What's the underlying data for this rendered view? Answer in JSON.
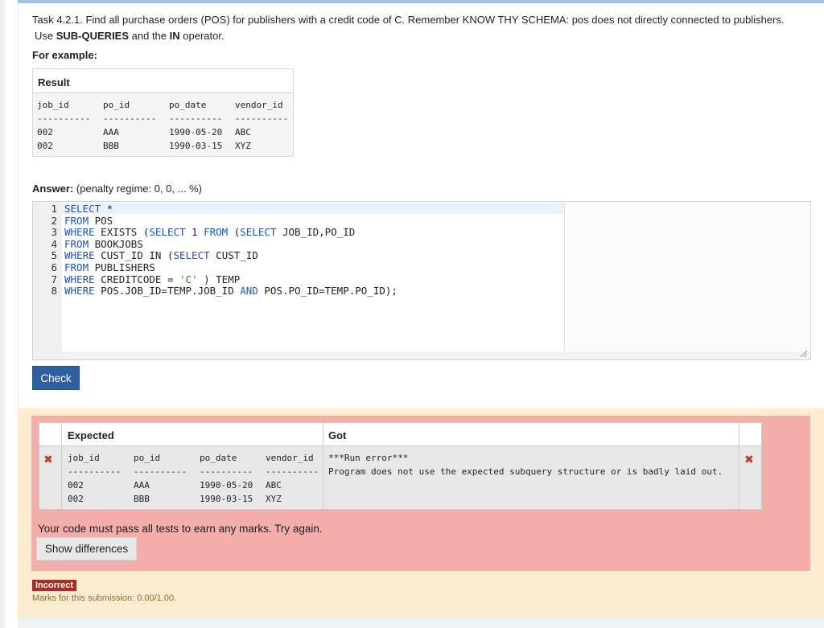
{
  "question": {
    "line1": "Task 4.2.1. Find all purchase orders (POS) for publishers with a credit code of C. Remember KNOW THY SCHEMA: pos does not directly connected to publishers.",
    "line2_pre": "Use ",
    "line2_b1": "SUB-QUERIES",
    "line2_mid": " and the ",
    "line2_b2": "IN",
    "line2_post": " operator.",
    "for_example": "For example:"
  },
  "example": {
    "header": "Result",
    "columns": [
      "job_id",
      "po_id",
      "po_date",
      "vendor_id"
    ],
    "separator": "----------",
    "rows": [
      [
        "002",
        "AAA",
        "1990-05-20",
        "ABC"
      ],
      [
        "002",
        "BBB",
        "1990-03-15",
        "XYZ"
      ]
    ]
  },
  "answer": {
    "label": "Answer:",
    "penalty": " (penalty regime: 0, 0, ... %)",
    "code": [
      {
        "n": "1",
        "parts": [
          [
            "kw",
            "SELECT"
          ],
          [
            "t",
            " *"
          ]
        ]
      },
      {
        "n": "2",
        "parts": [
          [
            "kw",
            "FROM"
          ],
          [
            "t",
            " POS"
          ]
        ]
      },
      {
        "n": "3",
        "parts": [
          [
            "kw",
            "WHERE"
          ],
          [
            "t",
            " EXISTS ("
          ],
          [
            "kw",
            "SELECT"
          ],
          [
            "t",
            " 1 "
          ],
          [
            "kw",
            "FROM"
          ],
          [
            "t",
            " ("
          ],
          [
            "kw",
            "SELECT"
          ],
          [
            "t",
            " JOB_ID,PO_ID"
          ]
        ]
      },
      {
        "n": "4",
        "parts": [
          [
            "kw",
            "FROM"
          ],
          [
            "t",
            " BOOKJOBS"
          ]
        ]
      },
      {
        "n": "5",
        "parts": [
          [
            "kw",
            "WHERE"
          ],
          [
            "t",
            " CUST_ID IN ("
          ],
          [
            "kw",
            "SELECT"
          ],
          [
            "t",
            " CUST_ID"
          ]
        ]
      },
      {
        "n": "6",
        "parts": [
          [
            "kw",
            "FROM"
          ],
          [
            "t",
            " PUBLISHERS"
          ]
        ]
      },
      {
        "n": "7",
        "parts": [
          [
            "kw",
            "WHERE"
          ],
          [
            "t",
            " CREDITCODE = "
          ],
          [
            "str",
            "'C'"
          ],
          [
            "t",
            " ) TEMP"
          ]
        ]
      },
      {
        "n": "8",
        "parts": [
          [
            "kw",
            "WHERE"
          ],
          [
            "t",
            " POS.JOB_ID=TEMP.JOB_ID "
          ],
          [
            "kw",
            "AND"
          ],
          [
            "t",
            " POS.PO_ID=TEMP.PO_ID);"
          ]
        ]
      }
    ],
    "check_label": "Check"
  },
  "feedback": {
    "expected_header": "Expected",
    "got_header": "Got",
    "columns": [
      "job_id",
      "po_id",
      "po_date",
      "vendor_id"
    ],
    "separator": "----------",
    "rows": [
      [
        "002",
        "AAA",
        "1990-05-20",
        "ABC"
      ],
      [
        "002",
        "BBB",
        "1990-03-15",
        "XYZ"
      ]
    ],
    "got_line1": "***Run error***",
    "got_line2": "Program does not use the expected subquery structure or is badly laid out.",
    "retry_message": "Your code must pass all tests to earn any marks. Try again.",
    "show_differences_label": "Show differences",
    "status_badge": "Incorrect",
    "marks": "Marks for this submission: 0.00/1.00."
  },
  "colors": {
    "keyword": "#1a53c4",
    "string": "#1b7e1b",
    "check_button": "#2f5f9f",
    "feedback_bg": "#f3adaa",
    "outer_bg": "#fbebcf",
    "badge": "#ad2b24"
  }
}
